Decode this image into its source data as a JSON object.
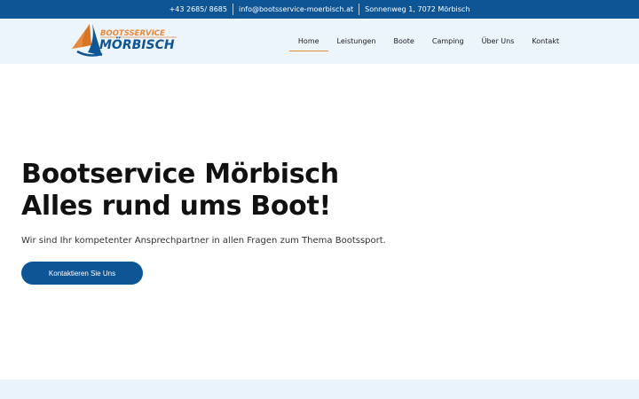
{
  "topbar": {
    "phone": "+43 2685/ 8685",
    "email": "info@bootsservice-moerbisch.at",
    "address": "Sonnenweg 1, 7072 Mörbisch"
  },
  "logo": {
    "line1": "BOOTSSERVICE",
    "line2": "MÖRBISCH"
  },
  "nav": {
    "items": [
      {
        "label": "Home",
        "active": true
      },
      {
        "label": "Leistungen"
      },
      {
        "label": "Boote"
      },
      {
        "label": "Camping"
      },
      {
        "label": "Über Uns"
      },
      {
        "label": "Kontakt"
      }
    ]
  },
  "hero": {
    "title_line1": "Bootservice Mörbisch",
    "title_line2": "Alles rund ums Boot!",
    "subtitle": "Wir sind Ihr kompetenter Ansprechpartner in allen Fragen zum Thema Bootssport.",
    "button_label": "Kontaktieren Sie Uns"
  },
  "colors": {
    "primary": "#0e5596",
    "accent": "#e88a3c",
    "header_bg": "#ecf4fc"
  }
}
